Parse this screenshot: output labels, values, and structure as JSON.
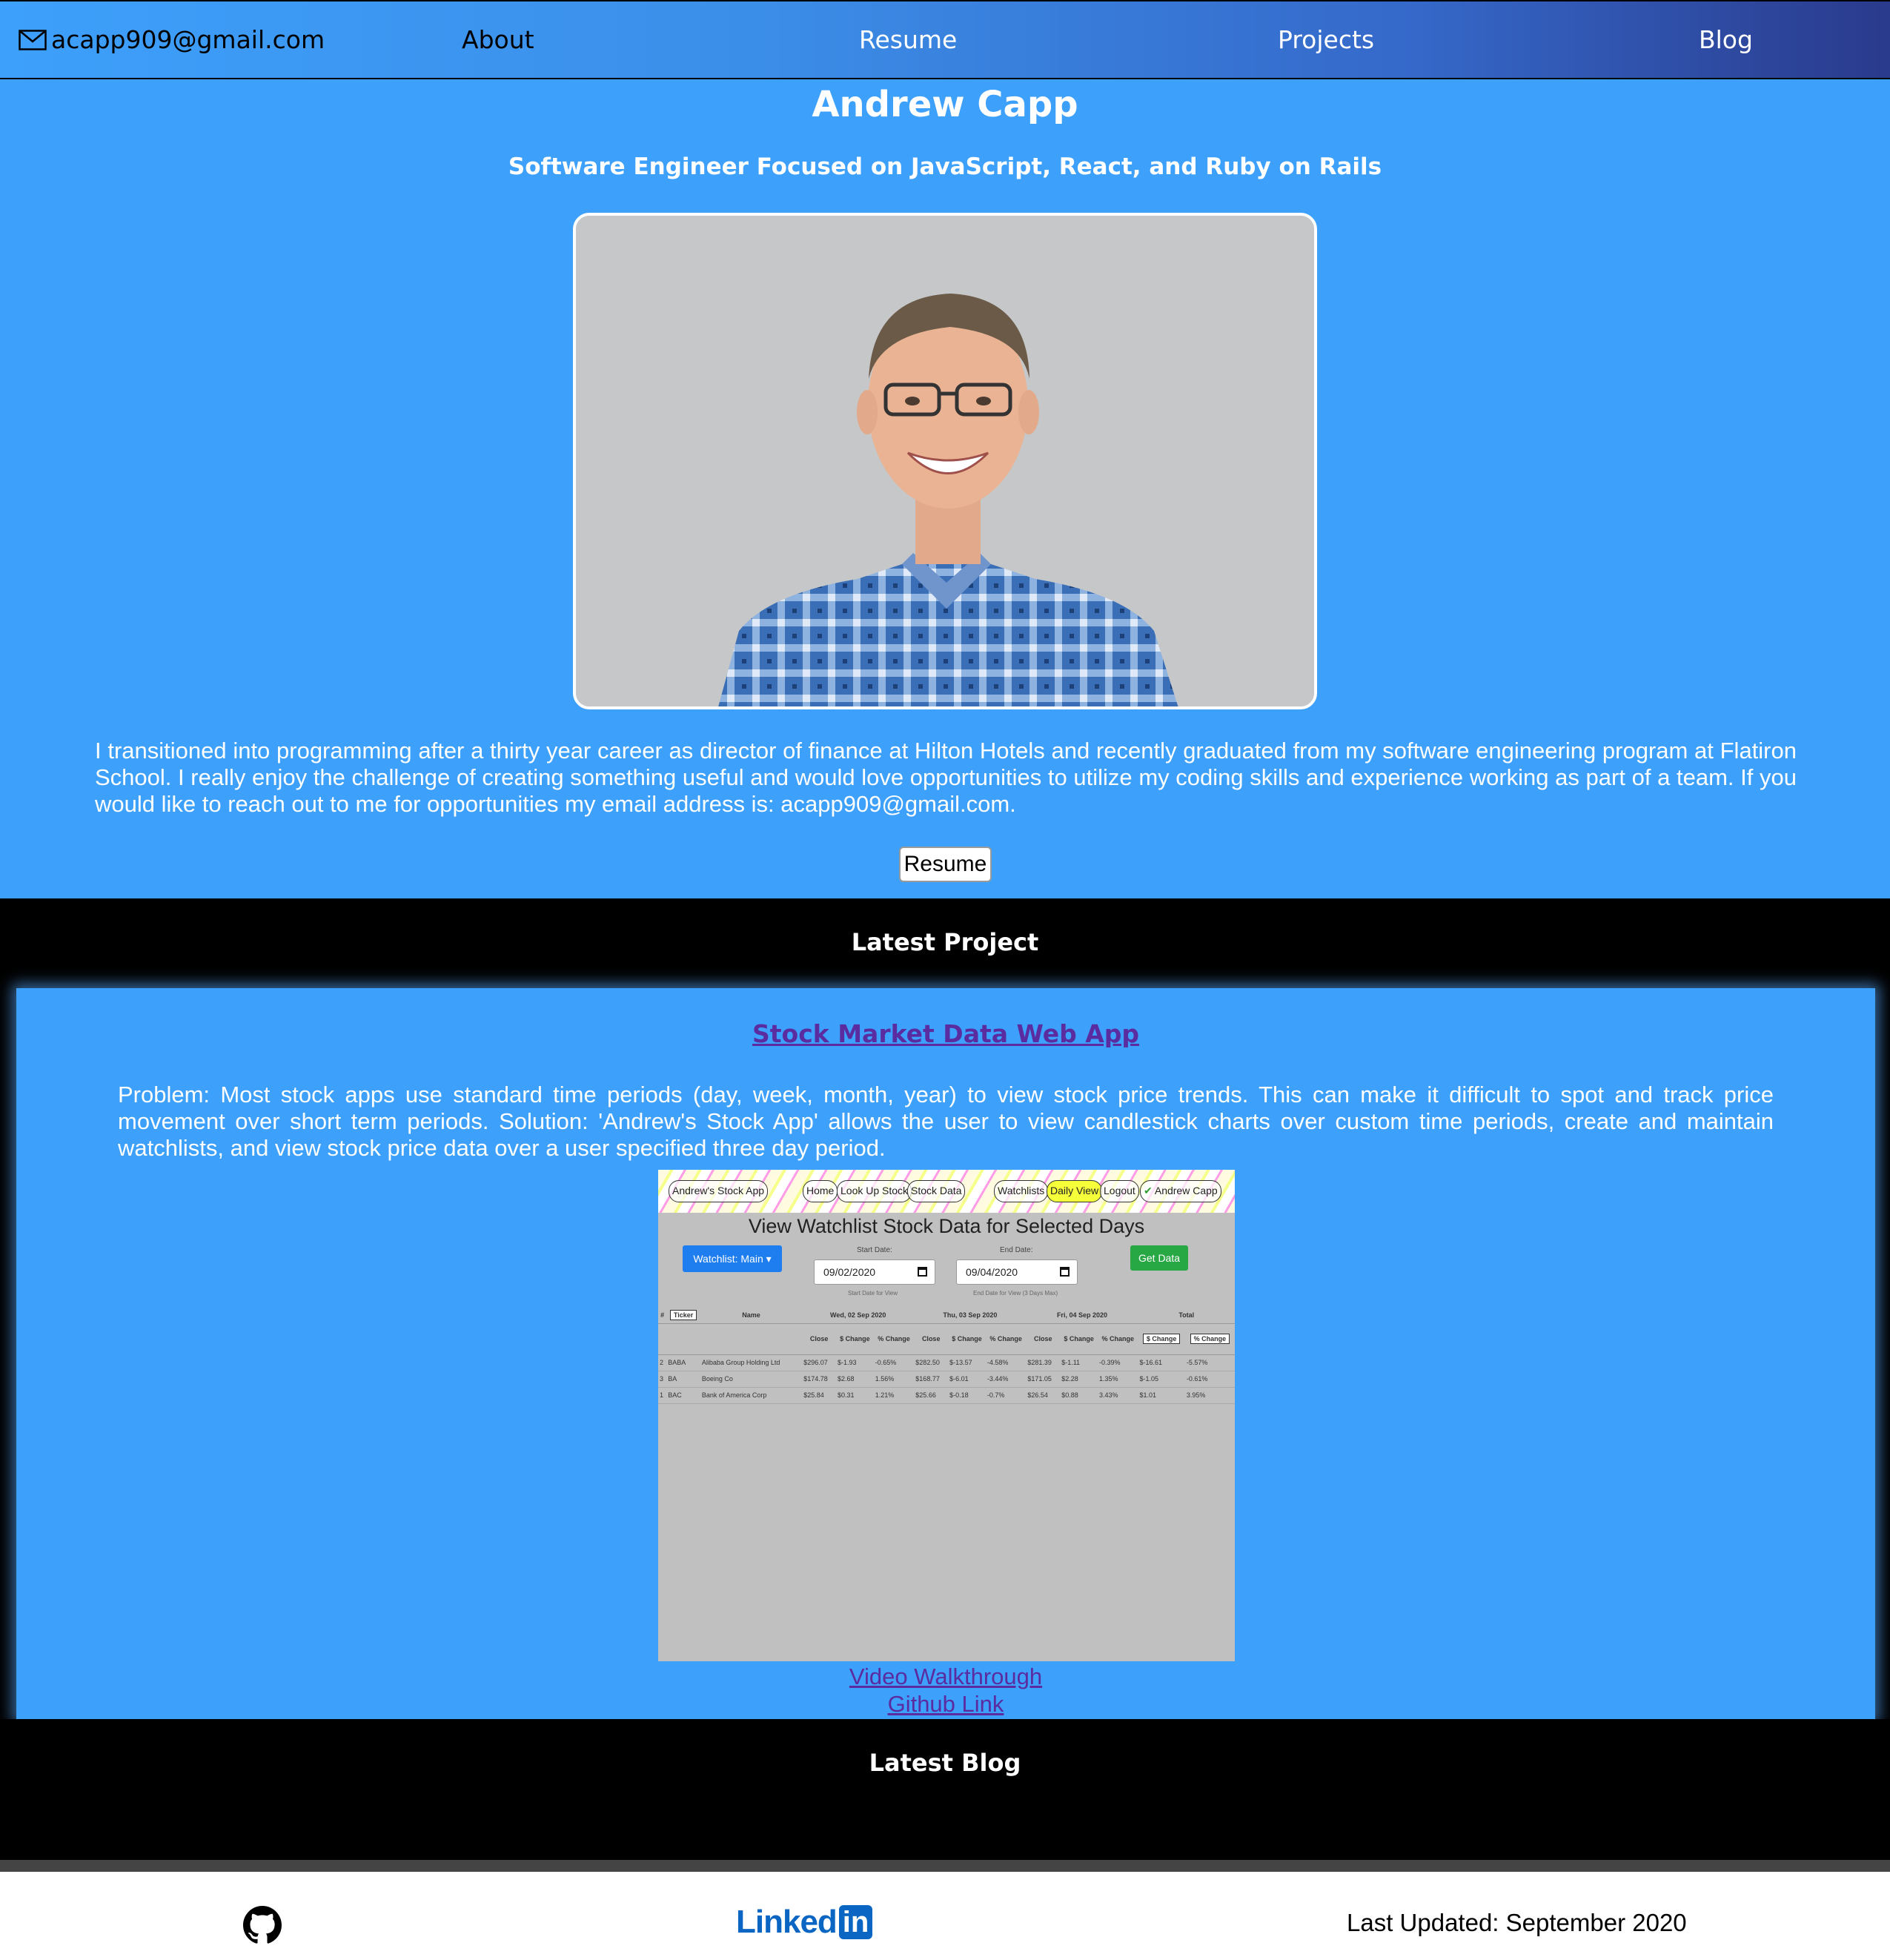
{
  "nav": {
    "email": "acapp909@gmail.com",
    "about": "About",
    "resume": "Resume",
    "projects": "Projects",
    "blog": "Blog"
  },
  "hero": {
    "name": "Andrew Capp",
    "tagline": "Software Engineer Focused on JavaScript, React, and Ruby on Rails",
    "bio": "I transitioned into programming after a thirty year career as director of finance at Hilton Hotels and recently graduated from my software engineering program at Flatiron School. I really enjoy the challenge of creating something useful and would love opportunities to utilize my coding skills and experience working as part of a team. If you would like to reach out to me for opportunities my email address is: acapp909@gmail.com.",
    "resume_button": "Resume"
  },
  "latest_project": {
    "heading": "Latest Project",
    "title": "Stock Market Data Web App",
    "description": "Problem: Most stock apps use standard time periods (day, week, month, year) to view stock price trends. This can make it difficult to spot and track price movement over short term periods. Solution: 'Andrew's Stock App' allows the user to view candlestick charts over custom time periods, create and maintain watchlists, and view stock price data over a user specified three day period.",
    "video_link": "Video Walkthrough",
    "github_link": "Github Link",
    "screenshot": {
      "nav": [
        "Andrew's Stock App",
        "Home",
        "Look Up Stock",
        "Stock Data",
        "Watchlists",
        "Daily View",
        "Logout",
        "Andrew Capp"
      ],
      "title": "View Watchlist Stock Data for Selected Days",
      "watchlist": "Watchlist: Main",
      "start_label": "Start Date:",
      "start_value": "09/02/2020",
      "start_hint": "Start Date for View",
      "end_label": "End Date:",
      "end_value": "09/04/2020",
      "end_hint": "End Date for View (3 Days Max)",
      "get_data": "Get Data",
      "col_hash": "#",
      "col_ticker": "Ticker",
      "col_name": "Name",
      "day1": "Wed, 02 Sep 2020",
      "day2": "Thu, 03 Sep 2020",
      "day3": "Fri, 04 Sep 2020",
      "total": "Total",
      "close": "Close",
      "dchange": "$ Change",
      "pchange": "% Change",
      "rows": [
        {
          "n": "2",
          "ticker": "BABA",
          "name": "Alibaba Group Holding Ltd",
          "c1": "$296.07",
          "d1": "$-1.93",
          "p1": "-0.65%",
          "c2": "$282.50",
          "d2": "$-13.57",
          "p2": "-4.58%",
          "c3": "$281.39",
          "d3": "$-1.11",
          "p3": "-0.39%",
          "td": "$-16.61",
          "tp": "-5.57%"
        },
        {
          "n": "3",
          "ticker": "BA",
          "name": "Boeing Co",
          "c1": "$174.78",
          "d1": "$2.68",
          "p1": "1.56%",
          "c2": "$168.77",
          "d2": "$-6.01",
          "p2": "-3.44%",
          "c3": "$171.05",
          "d3": "$2.28",
          "p3": "1.35%",
          "td": "$-1.05",
          "tp": "-0.61%"
        },
        {
          "n": "1",
          "ticker": "BAC",
          "name": "Bank of America Corp",
          "c1": "$25.84",
          "d1": "$0.31",
          "p1": "1.21%",
          "c2": "$25.66",
          "d2": "$-0.18",
          "p2": "-0.7%",
          "c3": "$26.54",
          "d3": "$0.88",
          "p3": "3.43%",
          "td": "$1.01",
          "tp": "3.95%"
        }
      ]
    }
  },
  "latest_blog": {
    "heading": "Latest Blog"
  },
  "footer": {
    "linkedin_word": "Linked",
    "linkedin_box": "in",
    "updated": "Last Updated: September 2020"
  },
  "icons": {
    "email": "envelope-icon",
    "github": "github-icon",
    "linkedin": "linkedin-logo"
  },
  "colors": {
    "primary_blue": "#3da0fb",
    "link_purple": "#5a2ca0",
    "linkedin_blue": "#0a66c2"
  }
}
